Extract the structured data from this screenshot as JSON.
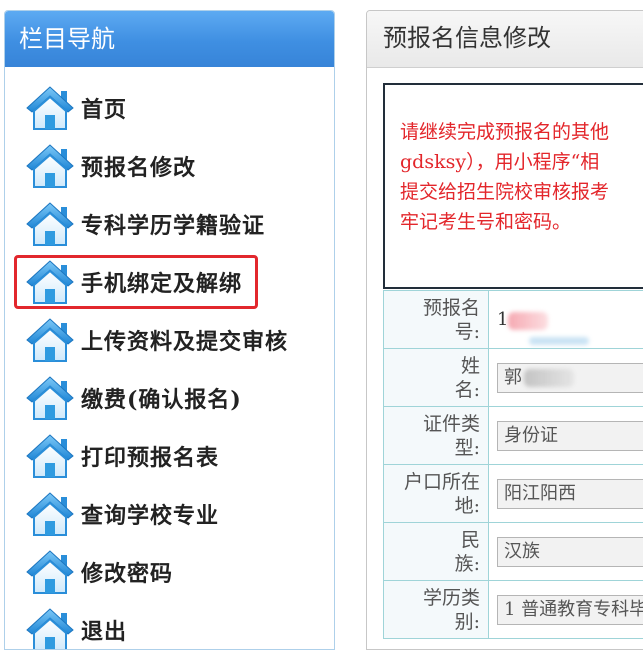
{
  "sidebar": {
    "title": "栏目导航",
    "items": [
      {
        "label": "首页",
        "icon": "home-icon"
      },
      {
        "label": "预报名修改",
        "icon": "home-icon"
      },
      {
        "label": "专科学历学籍验证",
        "icon": "home-icon"
      },
      {
        "label": "手机绑定及解绑",
        "icon": "home-icon"
      },
      {
        "label": "上传资料及提交审核",
        "icon": "home-icon"
      },
      {
        "label": "缴费(确认报名)",
        "icon": "home-icon"
      },
      {
        "label": "打印预报名表",
        "icon": "home-icon"
      },
      {
        "label": "查询学校专业",
        "icon": "home-icon"
      },
      {
        "label": "修改密码",
        "icon": "home-icon"
      },
      {
        "label": "退出",
        "icon": "home-icon"
      }
    ],
    "highlighted_item": "手机绑定及解绑",
    "highlight_color": "#e2272d"
  },
  "main": {
    "title": "预报名信息修改",
    "notice_lines": [
      "请继续完成预报名的其他",
      "gdsksy），用小程序“相",
      "提交给招生院校审核报考",
      "牢记考生号和密码。"
    ],
    "notice_color": "#e3262b",
    "form": {
      "prereg_no": {
        "label_line1": "预报名",
        "label_line2": "号:",
        "value": "1"
      },
      "name": {
        "label_line1": "姓",
        "label_line2": "名:",
        "value": "郭"
      },
      "id_type": {
        "label_line1": "证件类",
        "label_line2": "型:",
        "value": "身份证"
      },
      "household": {
        "label_line1": "户口所在",
        "label_line2": "地:",
        "value": "阳江阳西"
      },
      "ethnicity": {
        "label_line1": "民",
        "label_line2": "族:",
        "value": "汉族"
      },
      "education_type": {
        "label_line1": "学历类",
        "label_line2": "别:",
        "value": "1 普通教育专科毕"
      }
    }
  },
  "colors": {
    "header_blue": "#3f8fe2",
    "border_teal": "#9fd4d8",
    "icon_blue": "#2f9be0"
  }
}
